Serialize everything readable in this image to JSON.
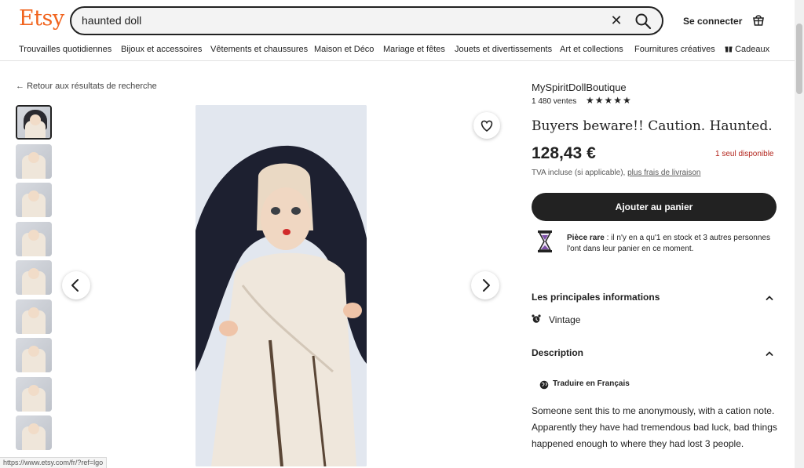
{
  "header": {
    "logo": "Etsy",
    "search_value": "haunted doll",
    "signin_label": "Se connecter"
  },
  "nav": {
    "items": [
      "Trouvailles quotidiennes",
      "Bijoux et accessoires",
      "Vêtements et chaussures",
      "Maison et Déco",
      "Mariage et fêtes",
      "Jouets et divertissements",
      "Art et collections",
      "Fournitures créatives",
      "Cadeaux"
    ]
  },
  "back_link": "Retour aux résultats de recherche",
  "product": {
    "shop_name": "MySpiritDollBoutique",
    "sales": "1 480 ventes",
    "rating_stars": 5,
    "title": "Buyers beware!! Caution. Haunted.",
    "price": "128,43 €",
    "stock_note": "1 seul disponible",
    "tva_text": "TVA incluse (si applicable),",
    "shipping_link": "plus frais de livraison",
    "add_to_cart": "Ajouter au panier",
    "rare_title": "Pièce rare",
    "rare_text": " : il n'y en a qu'1 en stock et 3 autres personnes l'ont dans leur panier en ce moment."
  },
  "sections": {
    "highlights_title": "Les principales informations",
    "vintage_label": "Vintage",
    "description_title": "Description",
    "translate_label": "Traduire en Français",
    "description_text": "Someone sent this to me anonymously, with a cation note. Apparently they have had tremendous bad luck, bad things happened enough to where they had lost 3 people."
  },
  "status_url": "https://www.etsy.com/fr/?ref=lgo",
  "colors": {
    "brand": "#f1641e",
    "stock": "#b3261e",
    "button": "#222222"
  }
}
